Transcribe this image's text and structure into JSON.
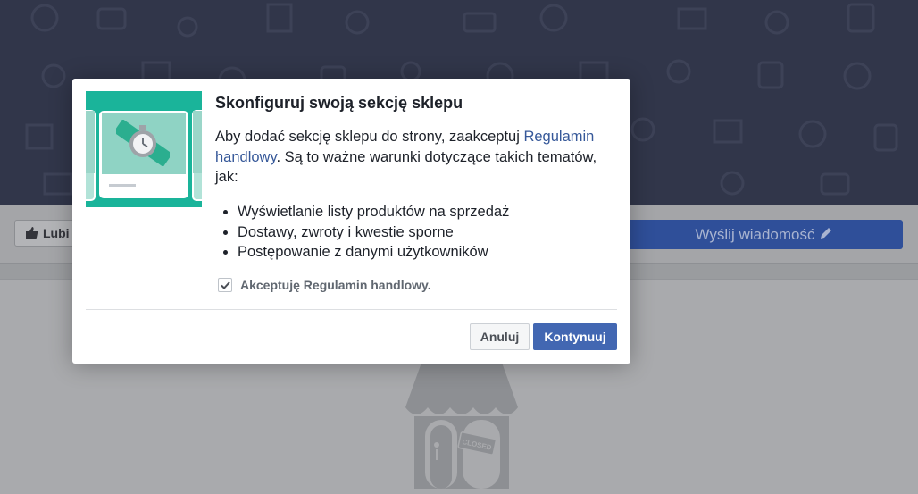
{
  "page": {
    "like_label": "Lubi",
    "send_message_label": "Wyślij wiadomość",
    "store_sign": "CLOSED"
  },
  "modal": {
    "title": "Skonfiguruj swoją sekcję sklepu",
    "intro_before_link": "Aby dodać sekcję sklepu do strony, zaakceptuj ",
    "link_text": "Regulamin handlowy",
    "intro_after_link": ". Są to ważne warunki dotyczące takich tematów, jak:",
    "bullets": [
      "Wyświetlanie listy produktów na sprzedaż",
      "Dostawy, zwroty i kwestie sporne",
      "Postępowanie z danymi użytkowników"
    ],
    "checkbox_label": "Akceptuję Regulamin handlowy.",
    "checkbox_checked": true,
    "cancel_label": "Anuluj",
    "continue_label": "Kontynuuj"
  },
  "colors": {
    "primary_button": "#4267b2",
    "link": "#365899",
    "thumbnail_bg": "#1ab49a"
  },
  "icons": [
    "thumbs-up-icon",
    "pencil-icon",
    "watch-icon",
    "checkmark-icon",
    "store-icon"
  ]
}
